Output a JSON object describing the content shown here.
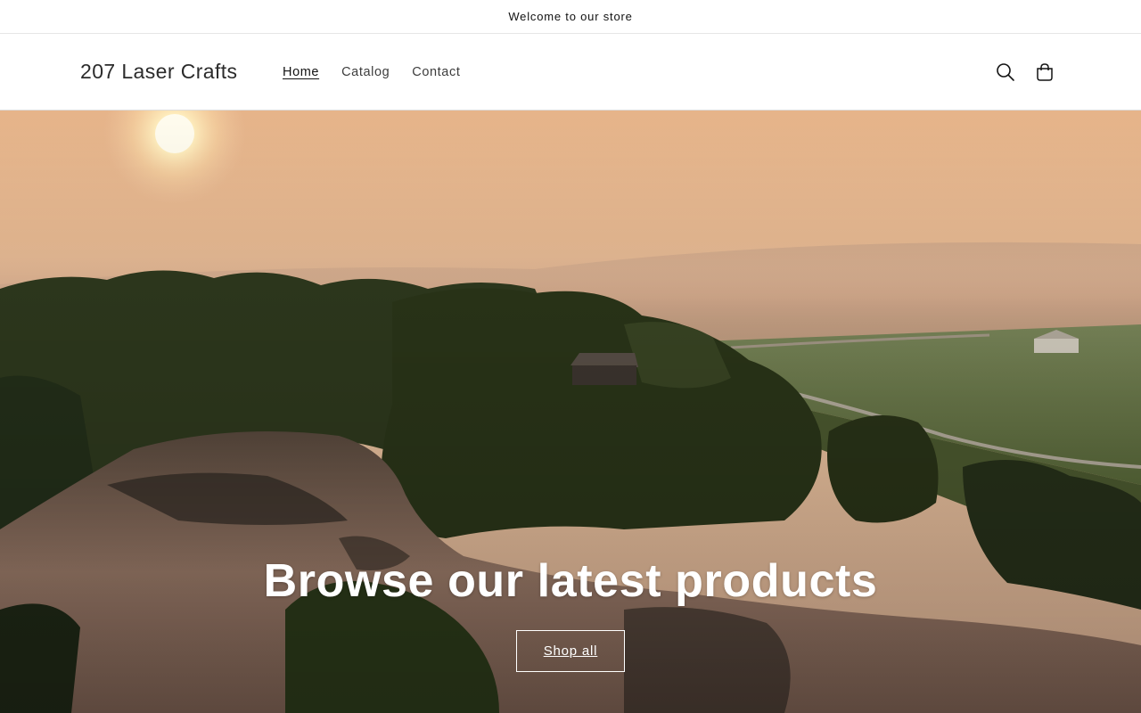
{
  "announcement": {
    "text": "Welcome to our store"
  },
  "header": {
    "logo": "207 Laser Crafts",
    "nav": [
      {
        "label": "Home",
        "active": true
      },
      {
        "label": "Catalog",
        "active": false
      },
      {
        "label": "Contact",
        "active": false
      }
    ],
    "icons": {
      "search": "search-icon",
      "cart": "cart-icon"
    }
  },
  "hero": {
    "title": "Browse our latest products",
    "button_label": "Shop all",
    "image": "misty-sunrise-over-pond-and-farmland"
  },
  "colors": {
    "text": "#121212",
    "sky": "#f2c9a0",
    "sun": "#fff3c9",
    "foliage": "#2f3a1e",
    "water": "#8a6a5a"
  }
}
